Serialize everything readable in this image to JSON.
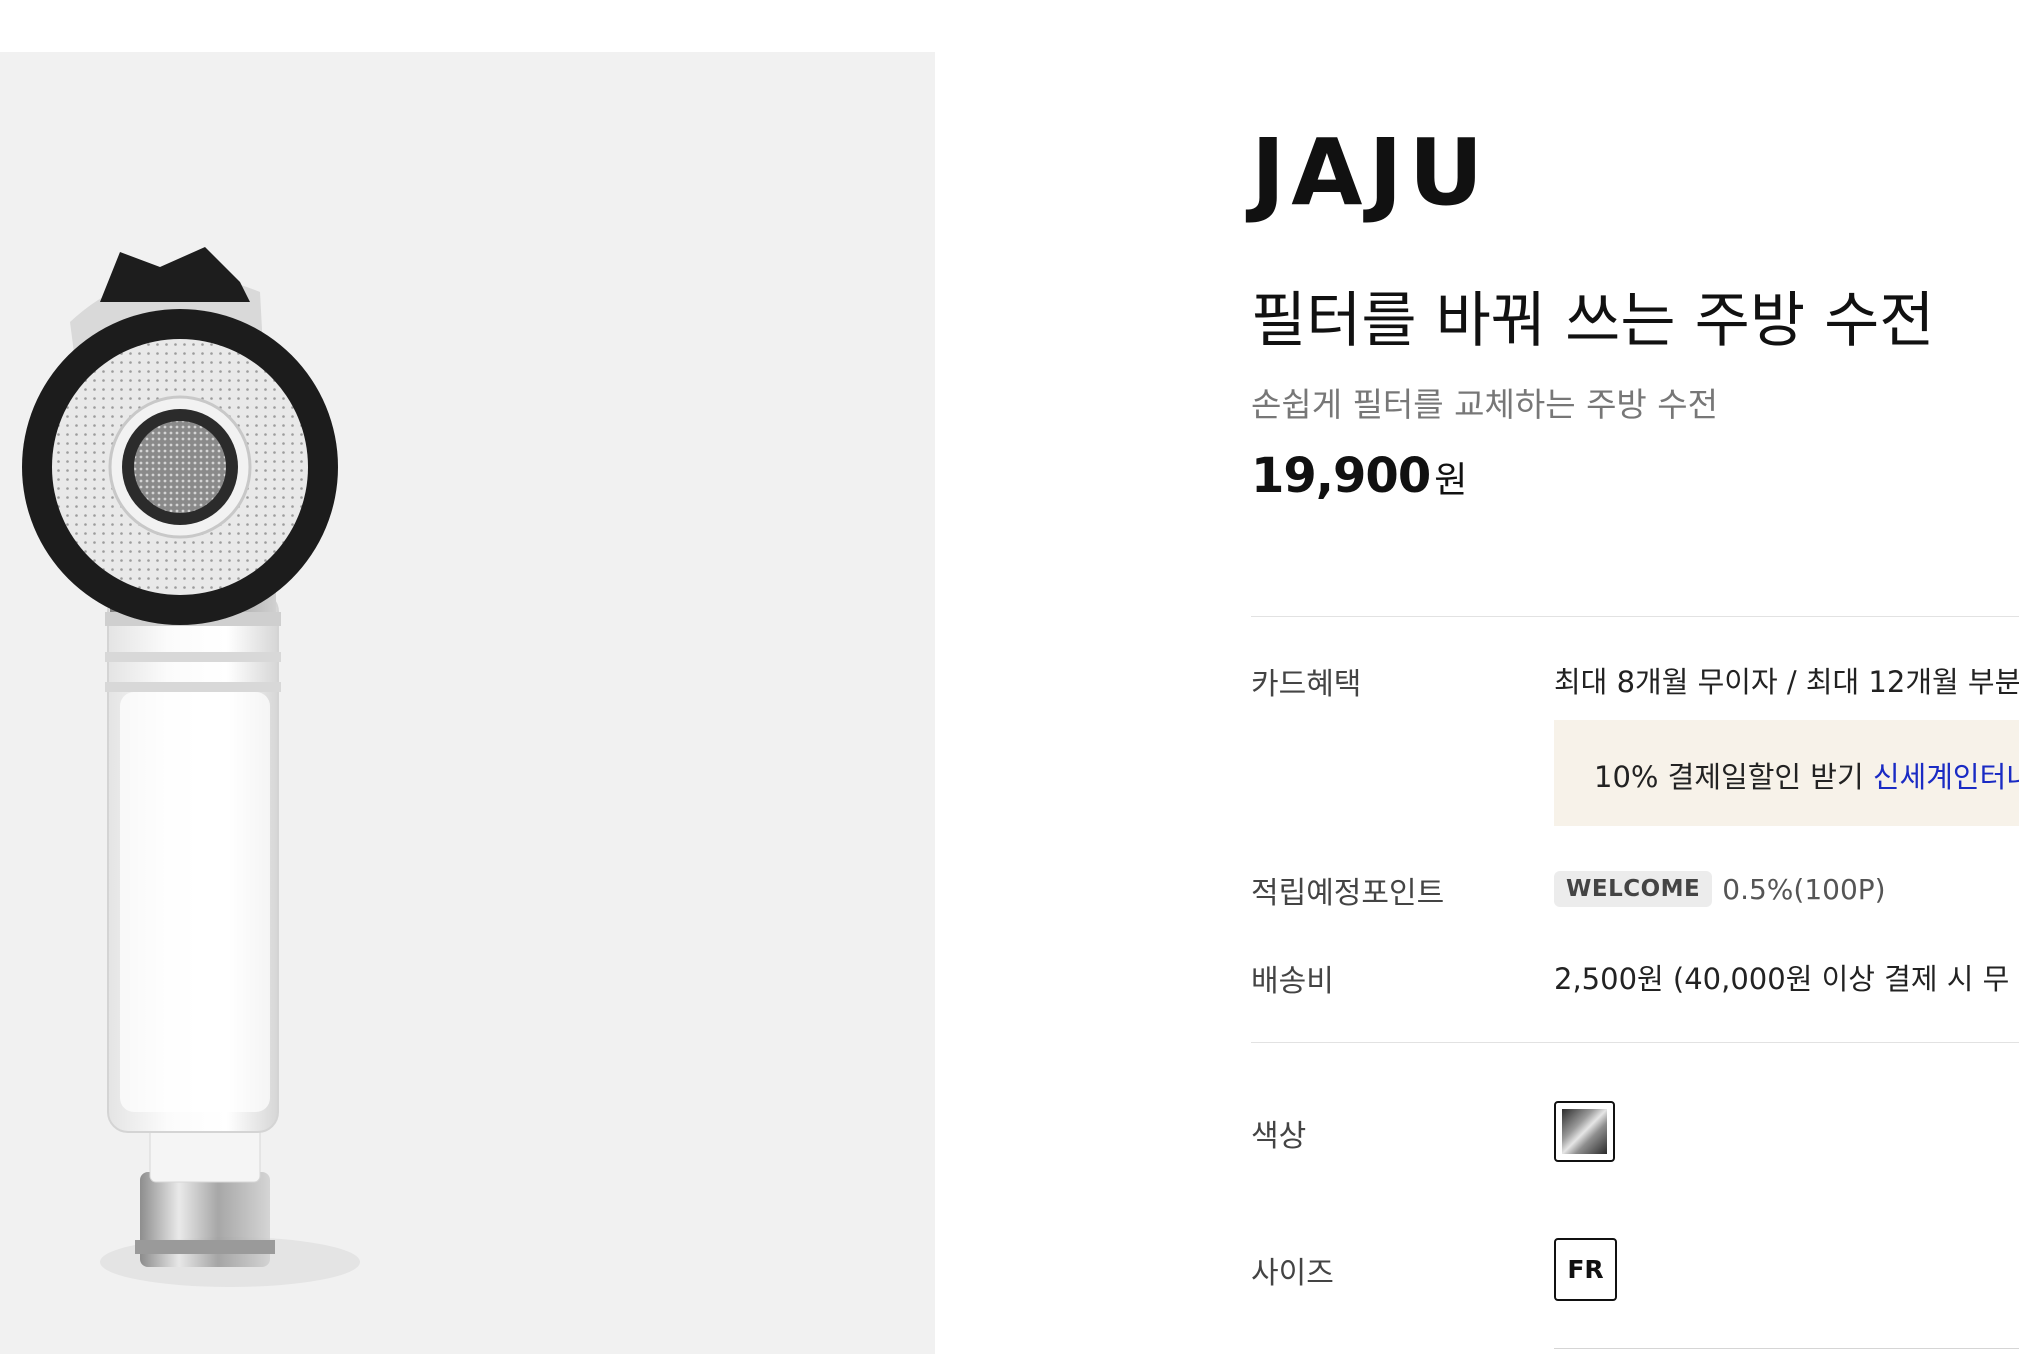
{
  "brand": {
    "name": "JAJU"
  },
  "product": {
    "title": "필터를 바꿔 쓰는 주방 수전",
    "subtitle": "손쉽게 필터를 교체하는 주방 수전",
    "price": "19,900",
    "price_unit": "원"
  },
  "card_benefit": {
    "label": "카드혜택",
    "value": "최대 8개월 무이자 / 최대 12개월 부분",
    "banner_text": "10% 결제일할인 받기",
    "banner_link": "신세계인터내"
  },
  "points": {
    "label": "적립예정포인트",
    "badge": "WELCOME",
    "rate": "0.5%(100P)"
  },
  "shipping": {
    "label": "배송비",
    "value": "2,500원 (40,000원 이상 결제 시 무"
  },
  "color_option": {
    "label": "색상",
    "swatch_icon": "chrome-swatch-icon"
  },
  "size_option": {
    "label": "사이즈",
    "value": "FR"
  },
  "colors": {
    "image_bg": "#f1f1f1",
    "banner_bg": "#f7f2e9",
    "link": "#1a2bc4",
    "badge_bg": "#ececec"
  }
}
